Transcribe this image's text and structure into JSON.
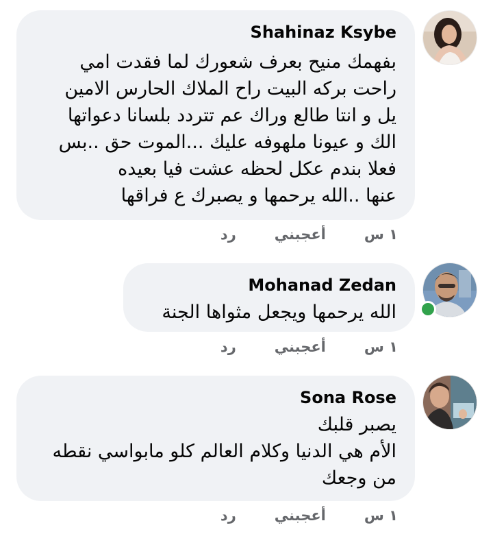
{
  "comments": [
    {
      "author": "Shahinaz Ksybe",
      "lines": [
        "بفهمك منيح بعرف شعورك لما فقدت امي",
        "راحت بركه البيت راح الملاك الحارس الامين",
        "يل و انتا طالع وراك عم تتردد بلسانا دعواتها",
        "الك و عيونا ملهوفه عليك ...الموت حق ..بس",
        "فعلا بندم عكل لحظه عشت فيا بعيده",
        "عنها ..الله يرحمها و يصبرك ع فراقها"
      ],
      "time": "١ س",
      "like_label": "أعجبني",
      "reply_label": "رد"
    },
    {
      "author": "Mohanad Zedan",
      "lines": [
        "الله يرحمها ويجعل مثواها الجنة"
      ],
      "time": "١ س",
      "like_label": "أعجبني",
      "reply_label": "رد",
      "online": true
    },
    {
      "author": "Sona Rose",
      "lines": [
        "يصبر قلبك",
        "الأم هي الدنيا وكلام العالم كلو مابواسي نقطه",
        "من وجعك"
      ],
      "time": "١ س",
      "like_label": "أعجبني",
      "reply_label": "رد"
    }
  ],
  "colors": {
    "bubble": "#f0f2f5",
    "text": "#050505",
    "secondary": "#65676b",
    "online": "#31a24c"
  }
}
